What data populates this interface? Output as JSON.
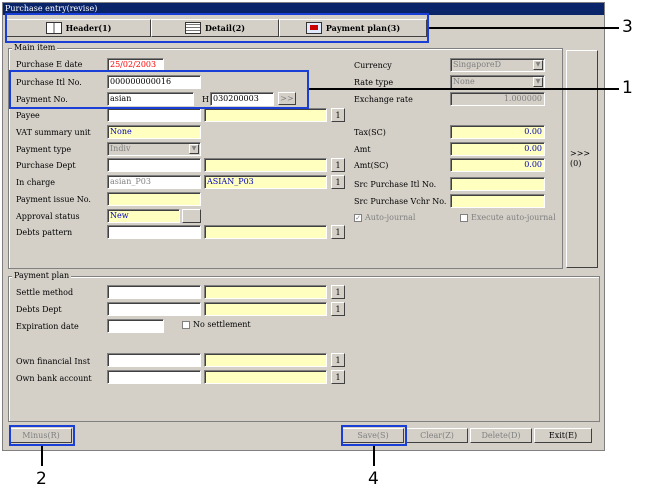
{
  "window": {
    "title": "Purchase entry(revise)"
  },
  "tabs": [
    {
      "label": "Header(1)",
      "icon": "book-icon"
    },
    {
      "label": "Detail(2)",
      "icon": "sheet-icon"
    },
    {
      "label": "Payment plan(3)",
      "icon": "screen-icon"
    }
  ],
  "main_item": {
    "group_label": "Main item",
    "purchase_e_date": {
      "label": "Purchase E date",
      "value": "25/02/2003"
    },
    "purchase_itl_no": {
      "label": "Purchase Itl No.",
      "value": "000000000016"
    },
    "payment_no": {
      "label": "Payment No.",
      "value1": "asian",
      "prefix": "H",
      "value2": "030200003",
      "button": ">>"
    },
    "payee": {
      "label": "Payee",
      "value": "",
      "name": ""
    },
    "vat_summary_unit": {
      "label": "VAT summary unit",
      "value": "None"
    },
    "payment_type": {
      "label": "Payment type",
      "value": "Indiv"
    },
    "purchase_dept": {
      "label": "Purchase Dept",
      "value": "",
      "name": ""
    },
    "in_charge": {
      "label": "In charge",
      "value": "asian_P03",
      "name": "ASIAN_P03"
    },
    "payment_issue_no": {
      "label": "Payment issue No.",
      "value": ""
    },
    "approval_status": {
      "label": "Approval status",
      "value": "New"
    },
    "debts_pattern": {
      "label": "Debts pattern",
      "value": "",
      "name": ""
    },
    "currency": {
      "label": "Currency",
      "value": "SingaporeD"
    },
    "rate_type": {
      "label": "Rate type",
      "value": "None"
    },
    "exchange_rate": {
      "label": "Exchange rate",
      "value": "1.000000"
    },
    "tax_sc": {
      "label": "Tax(SC)",
      "value": "0.00"
    },
    "amt": {
      "label": "Amt",
      "value": "0.00"
    },
    "amt_sc": {
      "label": "Amt(SC)",
      "value": "0.00"
    },
    "src_purchase_itl_no": {
      "label": "Src Purchase Itl No.",
      "value": ""
    },
    "src_purchase_vchr_no": {
      "label": "Src Purchase Vchr No.",
      "value": ""
    },
    "auto_journal": {
      "label": "Auto-journal",
      "checked": true
    },
    "execute_auto_journal": {
      "label": "Execute auto-journal",
      "checked": false
    },
    "side_button": ">>>(0)",
    "lookup_label": "1"
  },
  "payment_plan": {
    "group_label": "Payment plan",
    "settle_method": {
      "label": "Settle method",
      "value": "",
      "name": ""
    },
    "debts_dept": {
      "label": "Debts Dept",
      "value": "",
      "name": ""
    },
    "expiration_date": {
      "label": "Expiration date",
      "value": ""
    },
    "no_settlement": {
      "label": "No settlement",
      "checked": false
    },
    "own_financial_inst": {
      "label": "Own financial Inst",
      "value": "",
      "name": ""
    },
    "own_bank_account": {
      "label": "Own bank account",
      "value": "",
      "name": ""
    }
  },
  "footer": {
    "minus": "Minus(R)",
    "save": "Save(S)",
    "clear": "Clear(Z)",
    "delete": "Delete(D)",
    "exit": "Exit(E)"
  },
  "callouts": {
    "c1": "1",
    "c2": "2",
    "c3": "3",
    "c4": "4"
  },
  "colors": {
    "highlight": "#1a3fd6",
    "titlebar": "#0a246a",
    "required": "#ffffc0"
  }
}
